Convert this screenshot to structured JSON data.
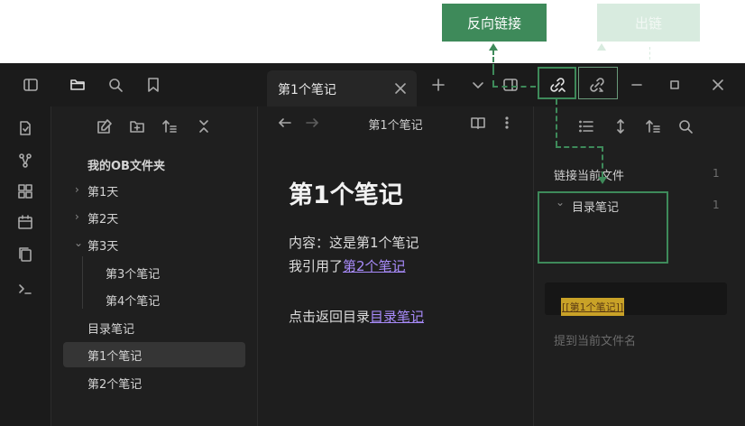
{
  "callouts": {
    "backlinks": "反向链接",
    "outgoing": "出链"
  },
  "tab": {
    "title": "第1个笔记"
  },
  "file_tree": {
    "vault": "我的OB文件夹",
    "items": [
      {
        "label": "第1天",
        "state": "collapsed"
      },
      {
        "label": "第2天",
        "state": "collapsed"
      },
      {
        "label": "第3天",
        "state": "expanded"
      },
      {
        "label": "第3个笔记"
      },
      {
        "label": "第4个笔记"
      },
      {
        "label": "目录笔记"
      },
      {
        "label": "第1个笔记",
        "selected": true
      },
      {
        "label": "第2个笔记"
      }
    ]
  },
  "editor": {
    "header_title": "第1个笔记",
    "heading": "第1个笔记",
    "line1": "内容：这是第1个笔记",
    "line2_prefix": "我引用了",
    "line2_link": "第2个笔记",
    "line3_prefix": "点击返回目录",
    "line3_link": "目录笔记"
  },
  "backlinks": {
    "linked_label": "链接当前文件",
    "linked_count": "1",
    "note_label": "目录笔记",
    "note_count": "1",
    "snippet": "[[第1个笔记]]",
    "unlinked_label": "提到当前文件名"
  },
  "colors": {
    "accent_green": "#3e8a5a",
    "link_purple": "#a88bfa",
    "highlight": "#c9a227"
  }
}
